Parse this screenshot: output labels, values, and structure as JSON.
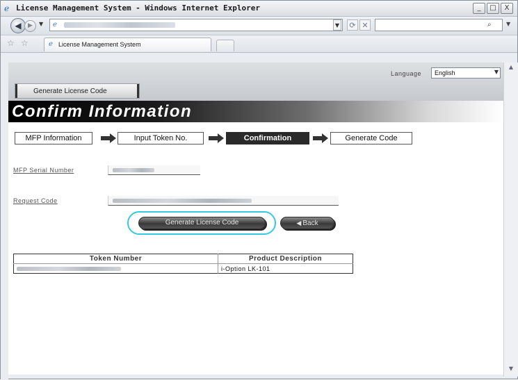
{
  "window": {
    "title": "License Management System - Windows Internet Explorer",
    "controls": [
      "_",
      "□",
      "X"
    ]
  },
  "browser": {
    "tab_label": "License Management System"
  },
  "page": {
    "language_label": "Language",
    "language_value": "English",
    "nav_tab": "Generate License Code",
    "banner_title": "Confirm Information",
    "steps": [
      {
        "label": "MFP Information",
        "active": false
      },
      {
        "label": "Input Token No.",
        "active": false
      },
      {
        "label": "Confirmation",
        "active": true
      },
      {
        "label": "Generate Code",
        "active": false
      }
    ],
    "fields": {
      "serial_label": "MFP Serial Number",
      "request_label": "Request Code"
    },
    "buttons": {
      "generate": "Generate License Code",
      "back": "Back"
    },
    "table": {
      "headers": [
        "Token Number",
        "Product Description"
      ],
      "rows": [
        {
          "token": "",
          "product": "i-Option LK-101"
        }
      ]
    }
  },
  "colors": {
    "highlight": "#36c8e0",
    "active_step": "#2a2a2a"
  }
}
